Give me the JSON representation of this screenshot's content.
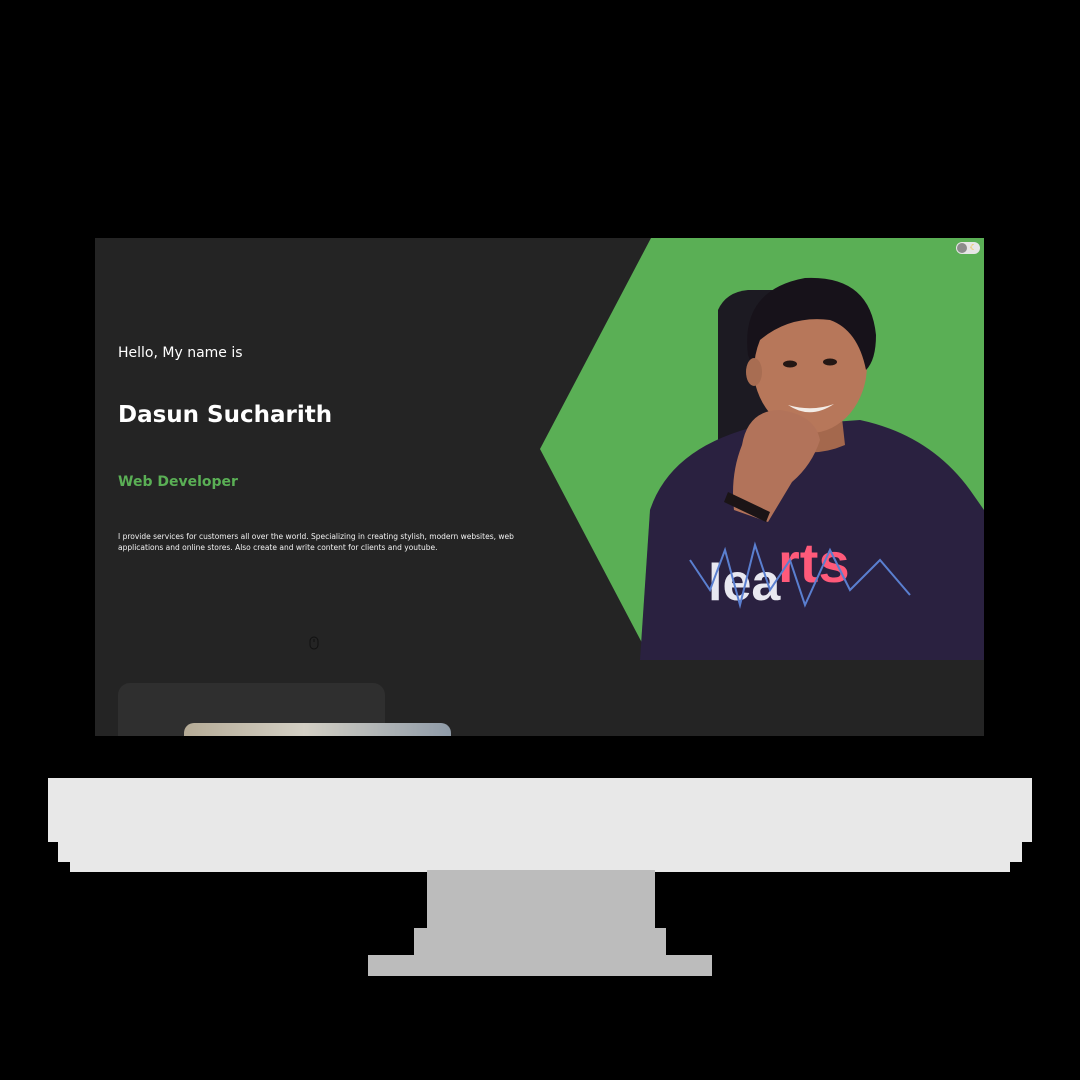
{
  "hero": {
    "greeting": "Hello, My name is",
    "name": "Dasun Sucharith",
    "role": "Web Developer",
    "bio": "I provide services for customers all over the world. Specializing in creating stylish, modern websites, web applications and online stores. Also create and write content for clients and youtube."
  },
  "theme_toggle": {
    "icon": "moon-icon",
    "state": "dark"
  },
  "scroll_indicator": {
    "icon": "mouse-icon"
  },
  "colors": {
    "accent_green": "#5aaf55",
    "background": "#242424",
    "text": "#ffffff",
    "shirt": "#2a2140",
    "shirt_print": "#ff5a7a"
  }
}
